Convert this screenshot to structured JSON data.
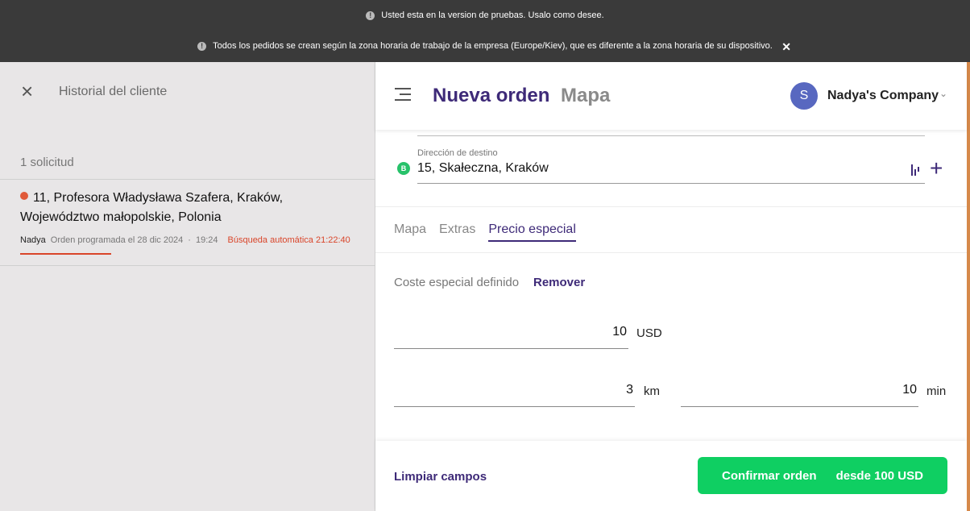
{
  "banner": {
    "test_notice": "Usted esta en la version de pruebas. Usalo como desee.",
    "timezone_notice": "Todos los pedidos se crean según la zona horaria de trabajo de la empresa (Europe/Kiev), que es diferente a la zona horaria de su dispositivo.",
    "close_glyph": "✕"
  },
  "left": {
    "title": "Historial del cliente",
    "count": "1 solicitud",
    "request": {
      "address": "11, Profesora Władysława Szafera, Kraków, Województwo małopolskie, Polonia",
      "user": "Nadya",
      "scheduled": "Orden programada el 28 dic 2024",
      "dot": "·",
      "time": "19:24",
      "auto": "Búsqueda automática 21:22:40"
    }
  },
  "header": {
    "title_new": "Nueva orden",
    "title_map": "Mapa",
    "avatar_letter": "S",
    "company": "Nadya's Company",
    "chevron": "⌄"
  },
  "destination": {
    "badge": "B",
    "label": "Dirección de destino",
    "value": "15, Skałeczna, Kraków",
    "plus": "+"
  },
  "tabs": [
    {
      "label": "Mapa"
    },
    {
      "label": "Extras"
    },
    {
      "label": "Precio especial"
    }
  ],
  "special": {
    "label": "Coste especial definido",
    "remove": "Remover"
  },
  "price": {
    "value": "10",
    "unit": "USD"
  },
  "distance": {
    "value": "3",
    "unit": "km"
  },
  "duration": {
    "value": "10",
    "unit": "min"
  },
  "footer": {
    "clear": "Limpiar campos",
    "confirm": "Confirmar orden",
    "from": "desde 100 USD"
  },
  "colors": {
    "accent": "#3e2a78",
    "confirm": "#0fcf62",
    "alert": "#d9452a",
    "banner": "#3a3a3a"
  },
  "icons": [
    "info-icon",
    "close-icon",
    "menu-icon",
    "clock-icon",
    "route-icon",
    "plus-icon",
    "chevron-down-icon"
  ]
}
